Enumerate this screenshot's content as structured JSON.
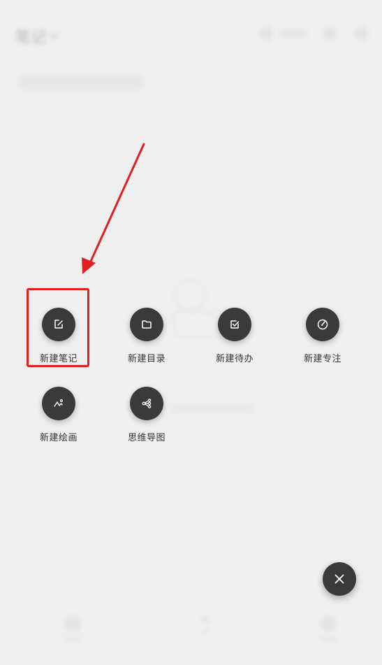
{
  "background": {
    "title": "笔记"
  },
  "actions": [
    {
      "id": "new-note",
      "label": "新建笔记",
      "icon": "edit-note-icon"
    },
    {
      "id": "new-folder",
      "label": "新建目录",
      "icon": "folder-icon"
    },
    {
      "id": "new-todo",
      "label": "新建待办",
      "icon": "checkbox-icon"
    },
    {
      "id": "new-focus",
      "label": "新建专注",
      "icon": "timer-icon"
    },
    {
      "id": "new-drawing",
      "label": "新建绘画",
      "icon": "drawing-icon"
    },
    {
      "id": "mind-map",
      "label": "思维导图",
      "icon": "mind-map-icon"
    }
  ],
  "colors": {
    "button_bg": "#3a3a3a",
    "icon": "#ffffff",
    "highlight": "#e02020",
    "page_bg": "#eeeeee"
  },
  "fab": {
    "icon": "close-icon"
  }
}
